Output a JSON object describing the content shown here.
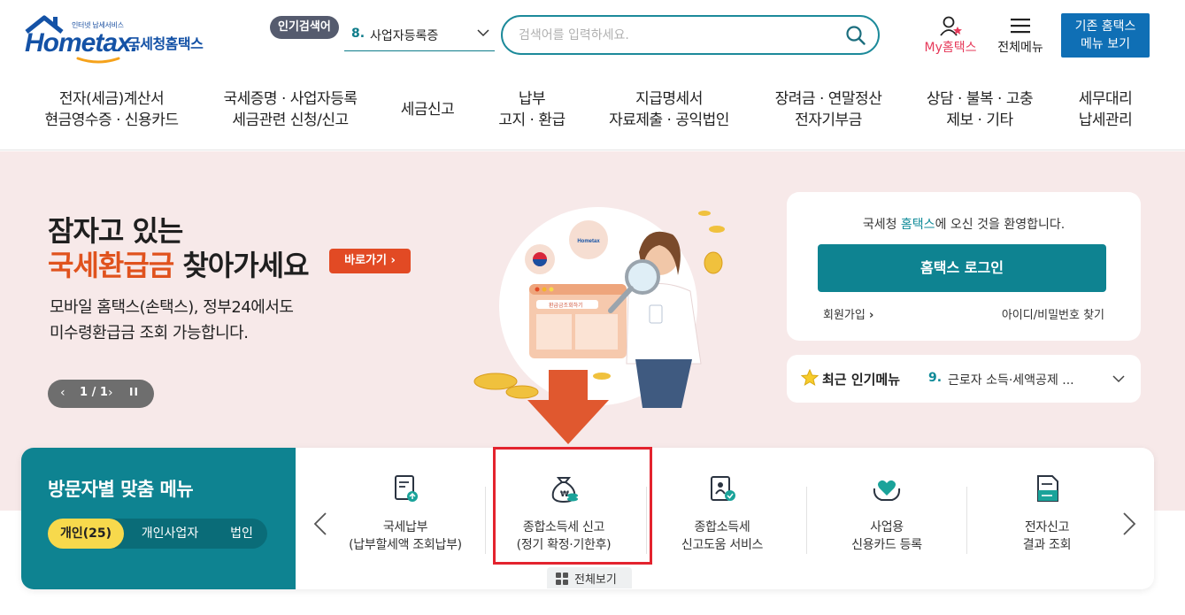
{
  "header": {
    "logo_small": "인터넷 납세서비스",
    "logo_main": "Hometax.",
    "logo_sub": "국세청홈택스",
    "popular_label": "인기검색어",
    "popular_rank": "8.",
    "popular_keyword": "사업자등록증",
    "search_placeholder": "검색어를 입력하세요.",
    "my_hometax": "My홈택스",
    "all_menu": "전체메뉴",
    "legacy_menu": "기존 홈택스\n메뉴 보기"
  },
  "nav": [
    {
      "label": "전자(세금)계산서\n현금영수증 · 신용카드"
    },
    {
      "label": "국세증명 · 사업자등록\n세금관련 신청/신고"
    },
    {
      "label": "세금신고"
    },
    {
      "label": "납부\n고지 · 환급"
    },
    {
      "label": "지급명세서\n자료제출 · 공익법인"
    },
    {
      "label": "장려금 · 연말정산\n전자기부금"
    },
    {
      "label": "상담 · 불복 · 고충\n제보 · 기타"
    },
    {
      "label": "세무대리\n납세관리"
    }
  ],
  "hero": {
    "title_line1": "잠자고 있는",
    "title_highlight": "국세환급금",
    "title_rest": " 찾아가세요",
    "go_button": "바로가기",
    "desc": "모바일 홈택스(손택스), 정부24에서도\n미수령환급금 조회 가능합니다.",
    "pager_count": "1 / 1",
    "illus_screen_text": "환급금조회하기",
    "illus_bubble_logo": "Hometax"
  },
  "login": {
    "welcome_prefix": "국세청 ",
    "welcome_brand": "홈택스",
    "welcome_suffix": "에 오신 것을 환영합니다.",
    "login_button": "홈택스 로그인",
    "join": "회원가입",
    "find_id": "아이디/비밀번호 찾기"
  },
  "recent": {
    "title": "최근 인기메뉴",
    "rank": "9.",
    "item": "근로자 소득·세액공제 ..."
  },
  "visitor": {
    "title": "방문자별 맞춤 메뉴",
    "tabs": [
      {
        "label": "개인(25)",
        "active": true
      },
      {
        "label": "개인사업자",
        "active": false
      },
      {
        "label": "법인",
        "active": false
      }
    ],
    "services": [
      {
        "label": "국세납부\n(납부할세액 조회납부)",
        "icon": "tax-payment-icon"
      },
      {
        "label": "종합소득세 신고\n(정기 확정·기한후)",
        "icon": "money-bag-icon"
      },
      {
        "label": "종합소득세\n신고도움 서비스",
        "icon": "help-document-icon"
      },
      {
        "label": "사업용\n신용카드 등록",
        "icon": "heart-hands-icon"
      },
      {
        "label": "전자신고\n결과 조회",
        "icon": "document-result-icon"
      }
    ],
    "view_all": "전체보기"
  },
  "colors": {
    "teal": "#0e8391",
    "accent_orange": "#e24a24",
    "highlight_red": "#e3232e",
    "hero_bg": "#f7e9e9",
    "legacy_blue": "#0f6fb5"
  }
}
